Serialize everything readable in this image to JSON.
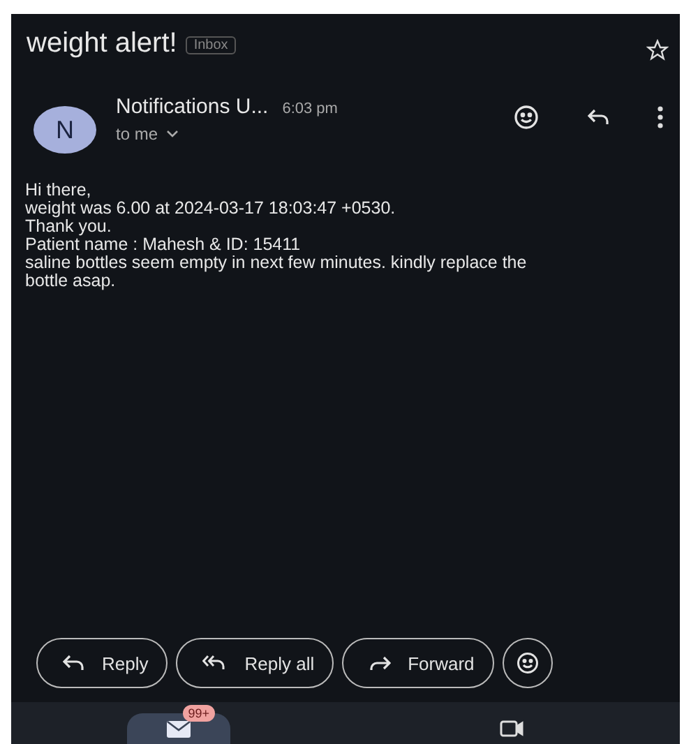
{
  "header": {
    "subject": "weight alert!",
    "label": "Inbox"
  },
  "message": {
    "avatar": "N",
    "sender": "Notifications U...",
    "time": "6:03 pm",
    "recipient": "to me",
    "body": [
      "Hi there,",
      "weight was 6.00 at 2024-03-17 18:03:47 +0530.",
      "Thank you.",
      "Patient name : Mahesh & ID: 15411",
      "saline bottles seem empty in next few minutes. kindly replace the bottle asap."
    ]
  },
  "actions": [
    {
      "kind": "reply",
      "label": "Reply"
    },
    {
      "kind": "reply_all",
      "label": "Reply all"
    },
    {
      "kind": "forward",
      "label": "Forward"
    },
    {
      "kind": "emoji"
    }
  ],
  "nav": [
    {
      "kind": "mail",
      "selected": true,
      "badge": "99+"
    },
    {
      "kind": "video",
      "selected": false
    }
  ]
}
